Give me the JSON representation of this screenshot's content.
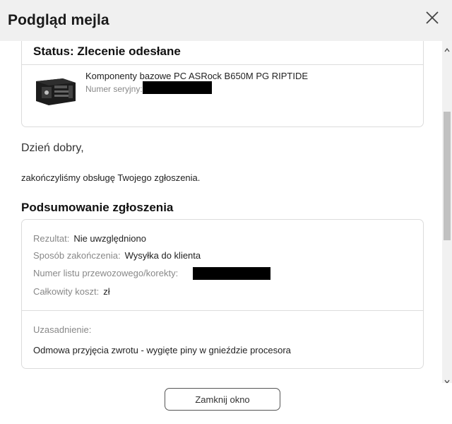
{
  "header": {
    "title": "Podgląd mejla",
    "close_icon": "close-icon"
  },
  "status_card": {
    "status_title": "Status: Zlecenie odesłane",
    "product_name": "Komponenty bazowe PC ASRock B650M PG RIPTIDE",
    "serial_label": "Numer seryjny:"
  },
  "message": {
    "greeting": "Dzień dobry,",
    "intro": "zakończyliśmy obsługę Twojego zgłoszenia."
  },
  "summary": {
    "title": "Podsumowanie zgłoszenia",
    "rows": [
      {
        "label": "Rezultat:",
        "value": "Nie uwzględniono"
      },
      {
        "label": "Sposób zakończenia:",
        "value": "Wysyłka do klienta"
      },
      {
        "label": "Numer listu przewozowego/korekty:",
        "value": ""
      },
      {
        "label": "Całkowity koszt:",
        "value": "zł"
      }
    ],
    "justification_label": "Uzasadnienie:",
    "justification_text": "Odmowa przyjęcia zwrotu - wygięte piny w gnieździe procesora"
  },
  "footer": {
    "close_button": "Zamknij okno"
  }
}
